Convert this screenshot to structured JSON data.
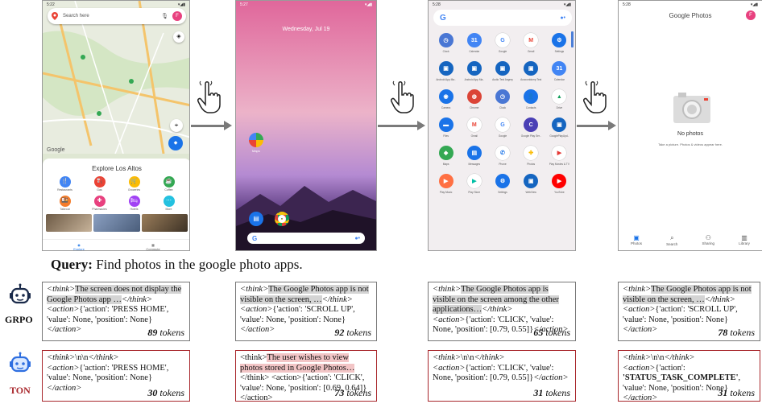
{
  "phones": {
    "maps": {
      "time": "5:22",
      "search_placeholder": "Search here",
      "avatar_letter": "F",
      "explore_title": "Explore Los Altos",
      "categories": [
        {
          "label": "Restaurants",
          "color": "#4285f4",
          "glyph": "🍴"
        },
        {
          "label": "Gas",
          "color": "#ea4335",
          "glyph": "⛽"
        },
        {
          "label": "Groceries",
          "color": "#fbbc04",
          "glyph": "🛒"
        },
        {
          "label": "Coffee",
          "color": "#34a853",
          "glyph": "☕"
        }
      ],
      "categories2": [
        {
          "label": "Takeout",
          "color": "#f57c2b",
          "glyph": "🍱"
        },
        {
          "label": "Pharmacies",
          "color": "#e8417f",
          "glyph": "✚"
        },
        {
          "label": "Hotels",
          "color": "#a142f4",
          "glyph": "🛏"
        },
        {
          "label": "More",
          "color": "#24c1e0",
          "glyph": "⋯"
        }
      ],
      "nav": {
        "explore": "Explore",
        "commute": "Commute"
      },
      "logo": "Google"
    },
    "home": {
      "time": "5:27",
      "date": "Wednesday, Jul 19",
      "maps_label": "Maps",
      "search_logo": "G"
    },
    "drawer": {
      "time": "5:28",
      "search_logo": "G",
      "apps": [
        {
          "name": "Clock",
          "color": "#4a77d4",
          "glyph": "◷"
        },
        {
          "name": "Calendar",
          "color": "#4285f4",
          "glyph": "31"
        },
        {
          "name": "Google",
          "color": "#ffffff",
          "glyph": "G",
          "fg": "#4285f4"
        },
        {
          "name": "Gmail",
          "color": "#ffffff",
          "glyph": "M",
          "fg": "#ea4335"
        },
        {
          "name": "Settings",
          "color": "#1a73e8",
          "glyph": "⚙"
        },
        {
          "name": "Android App Ma..",
          "color": "#1565c0",
          "glyph": "▣"
        },
        {
          "name": "Android App Ma..",
          "color": "#1565c0",
          "glyph": "▣"
        },
        {
          "name": "Audio Test Angrey",
          "color": "#1565c0",
          "glyph": "▣"
        },
        {
          "name": "Accountdump Test",
          "color": "#1565c0",
          "glyph": "▣"
        },
        {
          "name": "Calendar",
          "color": "#4285f4",
          "glyph": "31"
        },
        {
          "name": "Camera",
          "color": "#1a73e8",
          "glyph": "◉"
        },
        {
          "name": "Chrome",
          "color": "#db4437",
          "glyph": "◍"
        },
        {
          "name": "Clock",
          "color": "#4a77d4",
          "glyph": "◷"
        },
        {
          "name": "Contacts",
          "color": "#1a73e8",
          "glyph": "👤"
        },
        {
          "name": "Drive",
          "color": "#ffffff",
          "glyph": "▲",
          "fg": "#0f9d58"
        },
        {
          "name": "Files",
          "color": "#1a73e8",
          "glyph": "▬"
        },
        {
          "name": "Gmail",
          "color": "#ffffff",
          "glyph": "M",
          "fg": "#ea4335"
        },
        {
          "name": "Google",
          "color": "#ffffff",
          "glyph": "G",
          "fg": "#4285f4"
        },
        {
          "name": "Google Play Ser..",
          "color": "#4a3fb5",
          "glyph": "C"
        },
        {
          "name": "GooglePlayUpd..",
          "color": "#1565c0",
          "glyph": "▣"
        },
        {
          "name": "Maps",
          "color": "#34a853",
          "glyph": "◆"
        },
        {
          "name": "Messages",
          "color": "#1a73e8",
          "glyph": "▤"
        },
        {
          "name": "Phone",
          "color": "#ffffff",
          "glyph": "✆",
          "fg": "#1a73e8"
        },
        {
          "name": "Photos",
          "color": "#ffffff",
          "glyph": "✤",
          "fg": "#fbbc04"
        },
        {
          "name": "Play Movies & TV",
          "color": "#ffffff",
          "glyph": "▶",
          "fg": "#e53935"
        },
        {
          "name": "Play Music",
          "color": "#ff7043",
          "glyph": "▶"
        },
        {
          "name": "Play Store",
          "color": "#ffffff",
          "glyph": "▶",
          "fg": "#00bfa5"
        },
        {
          "name": "Settings",
          "color": "#1a73e8",
          "glyph": "⚙"
        },
        {
          "name": "WebView",
          "color": "#1565c0",
          "glyph": "▣"
        },
        {
          "name": "YouTube",
          "color": "#ff0000",
          "glyph": "▶"
        }
      ]
    },
    "photos": {
      "time": "5:28",
      "title": "Google Photos",
      "avatar_letter": "F",
      "empty_title": "No photos",
      "empty_sub": "Take a picture. Photos & videos appear here.",
      "nav": {
        "photos": "Photos",
        "search": "Search",
        "sharing": "Sharing",
        "library": "Library"
      }
    }
  },
  "query": {
    "label": "Query:",
    "text": "Find photos in the google photo apps."
  },
  "models": {
    "grpo": "GRPO",
    "ton": "TON"
  },
  "grpo_bubbles": [
    {
      "think": "The screen does not display the Google Photos app …",
      "action": "{'action': 'PRESS HOME', 'value': None, 'position': None}",
      "tokens_num": "89",
      "tokens_word": "tokens"
    },
    {
      "think": "The Google Photos app is not visible on the screen, …",
      "action": "{'action': 'SCROLL UP', 'value': None, 'position': None}",
      "tokens_num": "92",
      "tokens_word": "tokens"
    },
    {
      "think": "The Google Photos app is visible on the screen among the other applications…",
      "action": "{'action': 'CLICK', 'value': None, 'position': [0.79, 0.55]}",
      "tokens_num": "65",
      "tokens_word": "tokens"
    },
    {
      "think": "The Google Photos app is not visible on the screen, …",
      "action": "{'action': 'SCROLL UP', 'value': None, 'position': None}",
      "tokens_num": "78",
      "tokens_word": "tokens"
    }
  ],
  "ton_bubbles": [
    {
      "think": "\\n\\n",
      "action": "{'action': 'PRESS HOME', 'value': None, 'position': None}",
      "tokens_num": "30",
      "tokens_word": "tokens"
    },
    {
      "think": "The user wishes to view photos stored in Google Photos…",
      "action": "{'action': 'CLICK', 'value': None, 'position': [0.69, 0.64]}",
      "tokens_num": "73",
      "tokens_word": "tokens"
    },
    {
      "think": "\\n\\n",
      "action": "{'action': 'CLICK', 'value': None, 'position': [0.79, 0.55]}",
      "tokens_num": "31",
      "tokens_word": "tokens"
    },
    {
      "think": "\\n\\n",
      "action_pre": "{'action': ",
      "action_bold": "'STATUS_TASK_COMPLETE'",
      "action_post": ", 'value': None, 'position': None}",
      "tokens_num": "31",
      "tokens_word": "tokens"
    }
  ],
  "tags": {
    "think_open": "<think>",
    "think_close": "</think>",
    "action_open": "<action>",
    "action_close": "</action>"
  }
}
